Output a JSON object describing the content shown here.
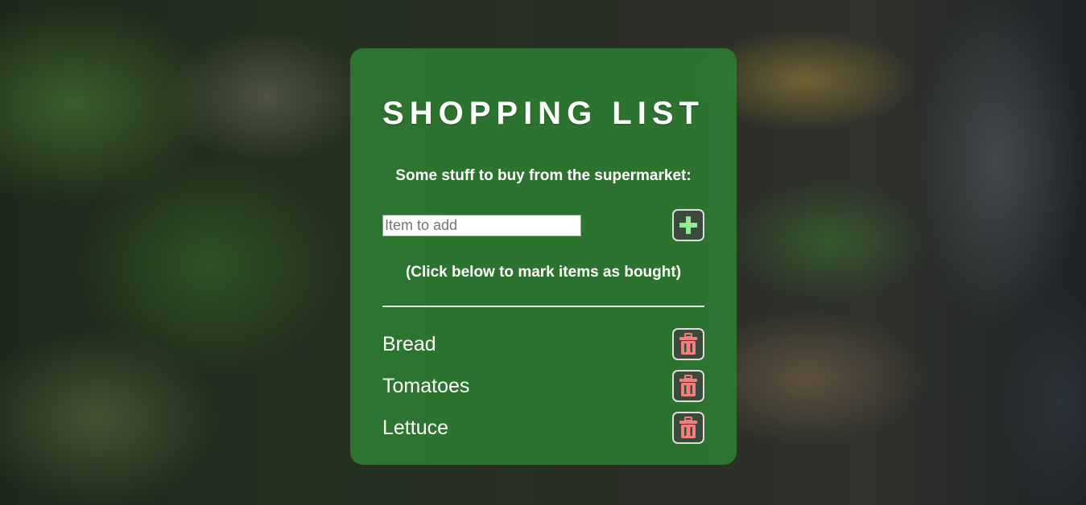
{
  "colors": {
    "card": "#2E7D32",
    "add_icon": "#90EE90",
    "trash_icon": "#F08080",
    "button_bg": "#3B4A3B"
  },
  "card": {
    "title": "SHOPPING LIST",
    "subtitle": "Some stuff to buy from the supermarket:",
    "input": {
      "placeholder": "Item to add",
      "value": ""
    },
    "add_button_icon": "plus-icon",
    "hint": "(Click below to mark items as bought)",
    "items": [
      {
        "label": "Bread",
        "delete_icon": "trash-icon"
      },
      {
        "label": "Tomatoes",
        "delete_icon": "trash-icon"
      },
      {
        "label": "Lettuce",
        "delete_icon": "trash-icon"
      }
    ]
  }
}
